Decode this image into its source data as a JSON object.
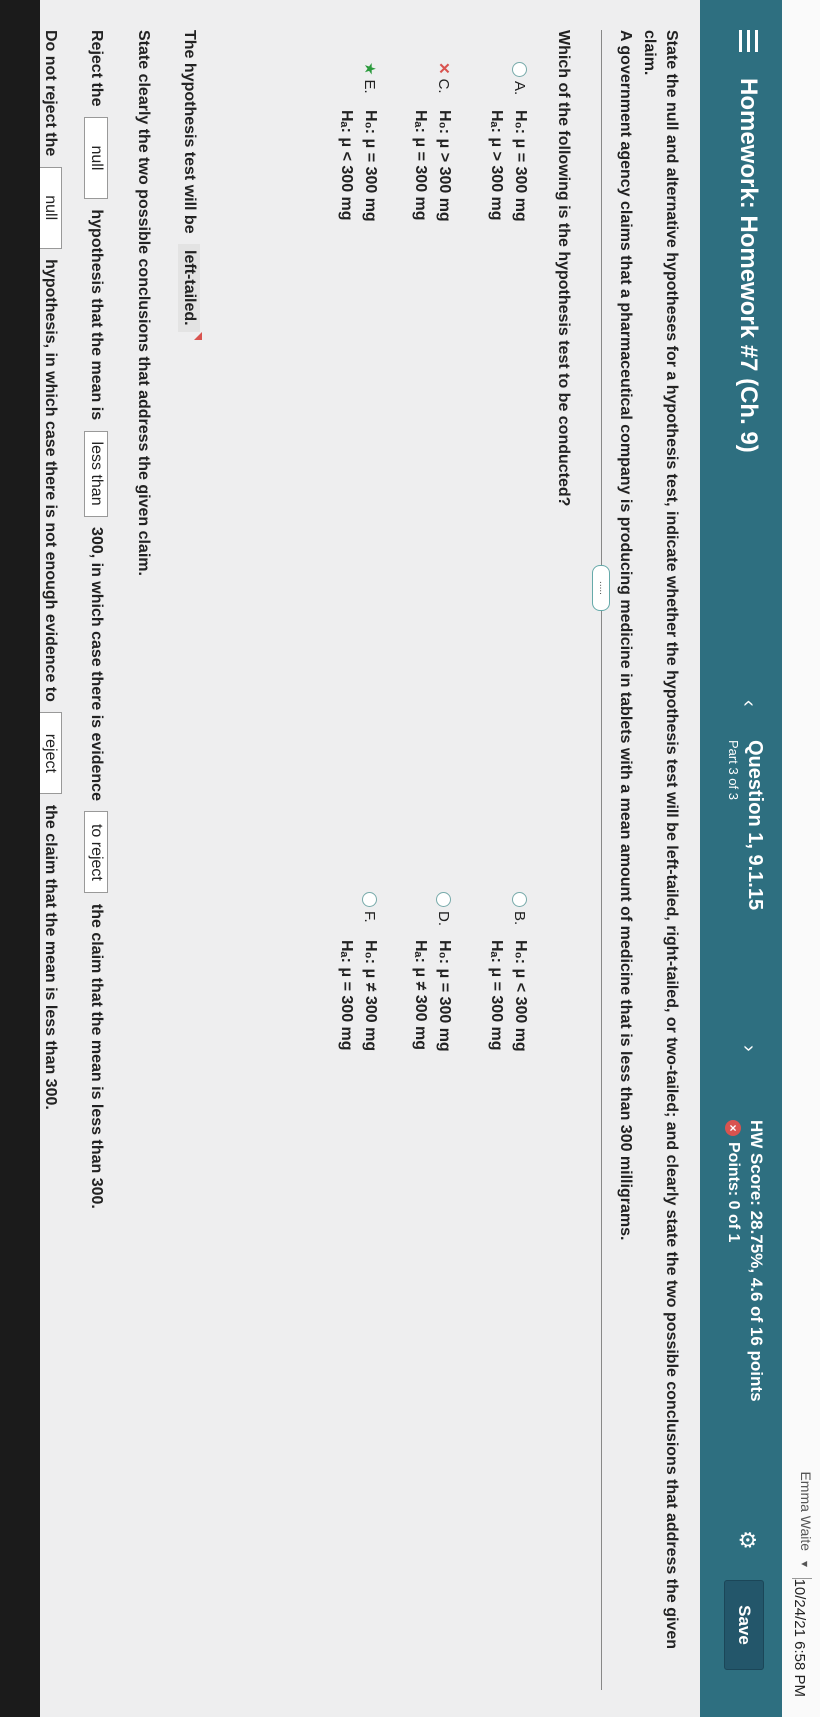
{
  "topbar": {
    "user": "Emma Waite",
    "datetime": "10/24/21 6:58 PM"
  },
  "header": {
    "title": "Homework: Homework #7 (Ch. 9)",
    "question_title": "Question 1, 9.1.15",
    "question_part": "Part 3 of 3",
    "hw_score": "HW Score: 28.75%, 4.6 of 16 points",
    "points": "Points: 0 of 1",
    "save_label": "Save"
  },
  "question": {
    "instructions": "State the null and alternative hypotheses for a hypothesis test, indicate whether the hypothesis test will be left-tailed, right-tailed, or two-tailed; and clearly state the two possible conclusions that address the given claim.",
    "claim": "A government agency claims that a pharmaceutical company is producing medicine in tablets with a mean amount of medicine that is less than 300 milligrams.",
    "expand_label": ".....",
    "prompt": "Which of the following is the hypothesis test to be conducted?"
  },
  "options": [
    {
      "letter": "A.",
      "h0": "H₀: μ = 300 mg",
      "ha": "Hₐ: μ > 300 mg",
      "status": "none"
    },
    {
      "letter": "B.",
      "h0": "H₀: μ < 300 mg",
      "ha": "Hₐ: μ = 300 mg",
      "status": "none"
    },
    {
      "letter": "C.",
      "h0": "H₀: μ > 300 mg",
      "ha": "Hₐ: μ = 300 mg",
      "status": "wrong"
    },
    {
      "letter": "D.",
      "h0": "H₀: μ = 300 mg",
      "ha": "Hₐ: μ ≠ 300 mg",
      "status": "none"
    },
    {
      "letter": "E.",
      "h0": "H₀: μ = 300 mg",
      "ha": "Hₐ: μ < 300 mg",
      "status": "correct"
    },
    {
      "letter": "F.",
      "h0": "H₀: μ ≠ 300 mg",
      "ha": "Hₐ: μ = 300 mg",
      "status": "none"
    }
  ],
  "tail": {
    "prefix": "The hypothesis test will be",
    "answer": "left-tailed."
  },
  "conclusions": {
    "prompt": "State clearly the two possible conclusions that address the given claim.",
    "reject": {
      "prefix": "Reject the",
      "box1": "null",
      "middle": "hypothesis that the mean is",
      "box2": "less than",
      "middle2": "300, in which case there is evidence",
      "box3": "to reject",
      "suffix": "the claim that the mean is less than 300."
    },
    "not_reject": {
      "prefix": "Do not reject the",
      "box1": "null",
      "middle": "hypothesis, in which case there is not enough evidence to",
      "box2": "reject",
      "suffix": "the claim that the mean is less than 300."
    }
  }
}
